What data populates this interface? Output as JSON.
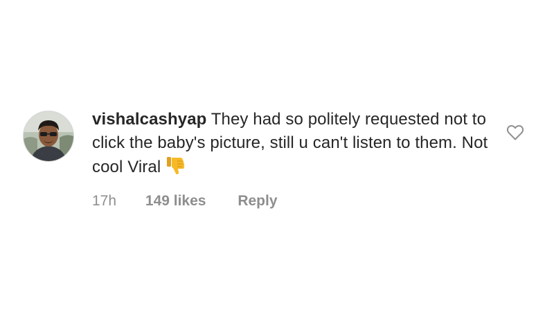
{
  "comment": {
    "username": "vishalcashyap",
    "text": " They had so politely requested not to click the baby's picture, still u can't listen to them. Not cool Viral",
    "emoji_icon": "thumbs-down-icon",
    "time": "17h",
    "likes": "149 likes",
    "reply_label": "Reply",
    "like_icon": "heart-outline-icon",
    "colors": {
      "text": "#262626",
      "meta": "#8e8e8e",
      "emoji": "#f7b928"
    }
  }
}
